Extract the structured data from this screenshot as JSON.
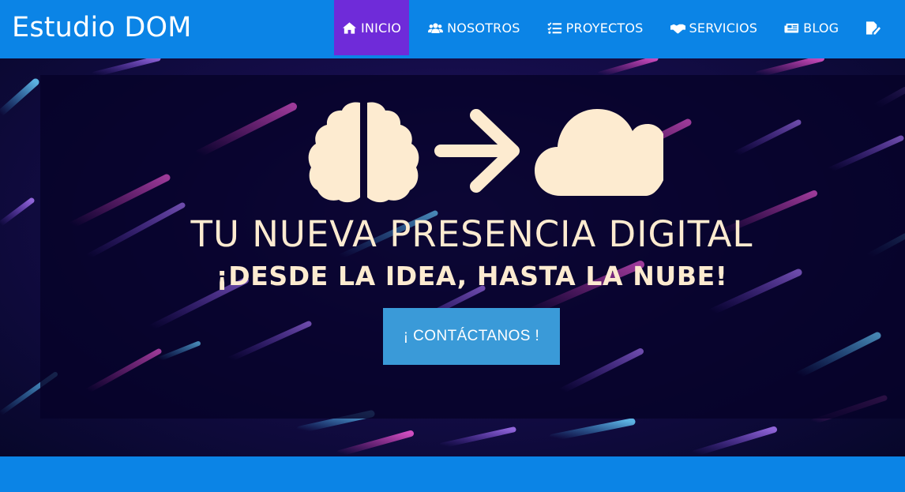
{
  "brand": "Estudio DOM",
  "nav": [
    {
      "label": "INICIO",
      "icon": "home-icon",
      "active": true
    },
    {
      "label": "NOSOTROS",
      "icon": "users-icon",
      "active": false
    },
    {
      "label": "PROYECTOS",
      "icon": "tasks-icon",
      "active": false
    },
    {
      "label": "SERVICIOS",
      "icon": "handshake-icon",
      "active": false
    },
    {
      "label": "BLOG",
      "icon": "newspaper-icon",
      "active": false
    },
    {
      "label": "",
      "icon": "file-signature-icon",
      "active": false
    }
  ],
  "hero": {
    "headline": "TU NUEVA PRESENCIA DIGITAL",
    "subline": "¡DESDE LA IDEA, HASTA LA NUBE!",
    "cta_label": "¡ CONTÁCTANOS !",
    "icons": [
      "brain-icon",
      "arrow-right-icon",
      "cloud-icon"
    ]
  },
  "colors": {
    "navbar": "#0b84e6",
    "active_nav": "#6f2bd9",
    "hero_text": "#fdebd0",
    "cta": "#3a9ad8"
  }
}
